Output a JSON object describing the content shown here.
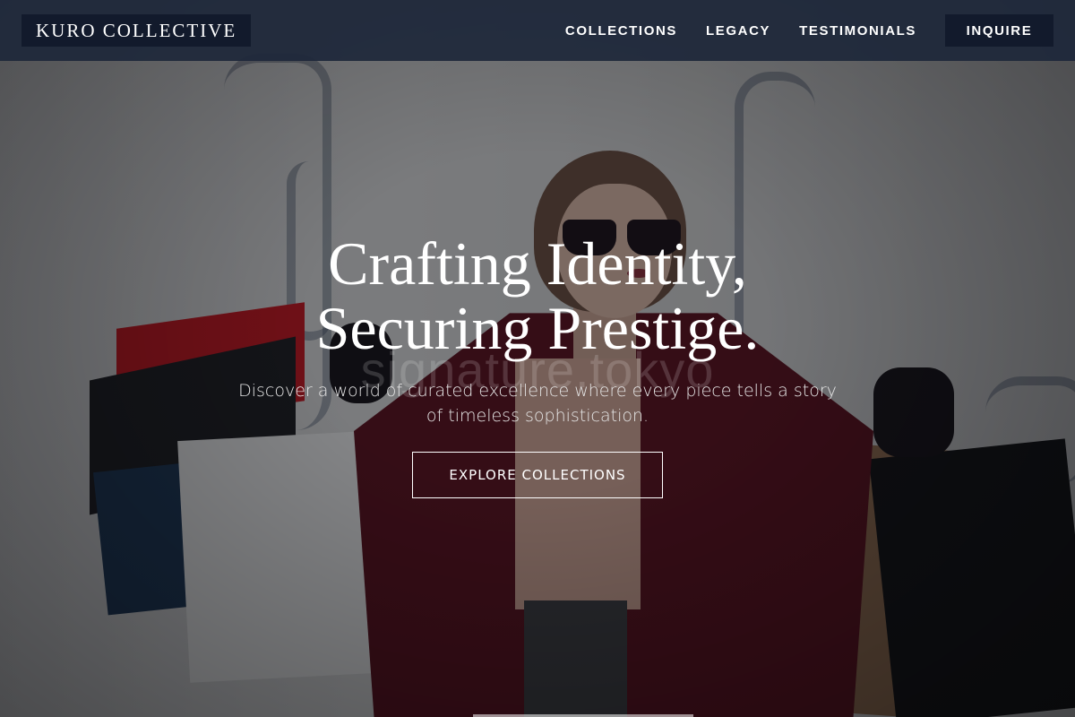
{
  "header": {
    "logo": "KURO COLLECTIVE",
    "nav": [
      {
        "label": "COLLECTIONS"
      },
      {
        "label": "LEGACY"
      },
      {
        "label": "TESTIMONIALS"
      }
    ],
    "cta_label": "INQUIRE"
  },
  "hero": {
    "title_line1": "Crafting Identity,",
    "title_line2": "Securing Prestige.",
    "watermark": "signature.tokyo",
    "subtitle": "Discover a world of curated excellence where every piece tells a story of timeless sophistication.",
    "cta_label": "EXPLORE COLLECTIONS"
  },
  "colors": {
    "header_bg": "#1e283a",
    "button_bg": "#121a2c",
    "text": "#ffffff"
  }
}
